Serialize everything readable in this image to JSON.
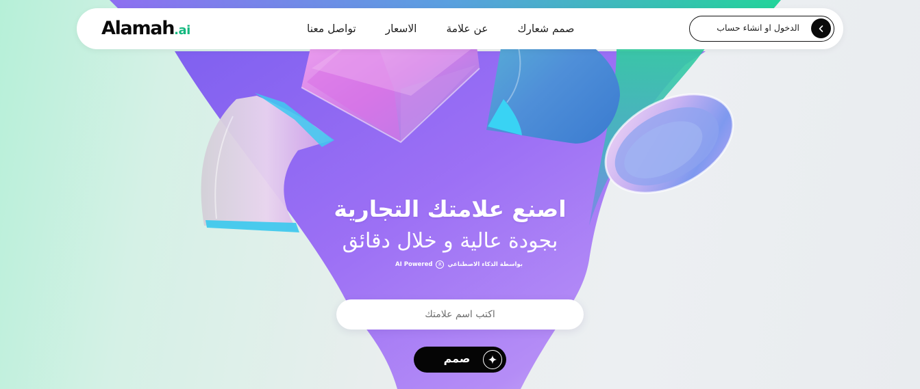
{
  "header": {
    "logo": {
      "main": "Alamah",
      "tld": ".ai"
    },
    "nav": [
      {
        "id": "design-logo",
        "label": "صمم شعارك"
      },
      {
        "id": "about",
        "label": "عن علامة"
      },
      {
        "id": "pricing",
        "label": "الاسعار"
      },
      {
        "id": "contact",
        "label": "تواصل معنا"
      }
    ],
    "login": {
      "label": "الدخول او انشاء حساب",
      "icon": "chevron-left-icon"
    }
  },
  "hero": {
    "title": "اصنع علامتك التجارية",
    "subtitle": "بجودة عالية و خلال دقائق",
    "powered_ar": "بواسطة الذكاء الاصطناعي",
    "powered_en": "AI Powered",
    "registered_mark": "R"
  },
  "form": {
    "brand_input": {
      "placeholder": "اكتب اسم علامتك",
      "value": ""
    },
    "submit": {
      "label": "صمم",
      "icon": "sparkle-icon"
    }
  },
  "colors": {
    "accent_green": "#14b87f",
    "purple": "#9f6cf4",
    "button_dark": "#050505"
  }
}
